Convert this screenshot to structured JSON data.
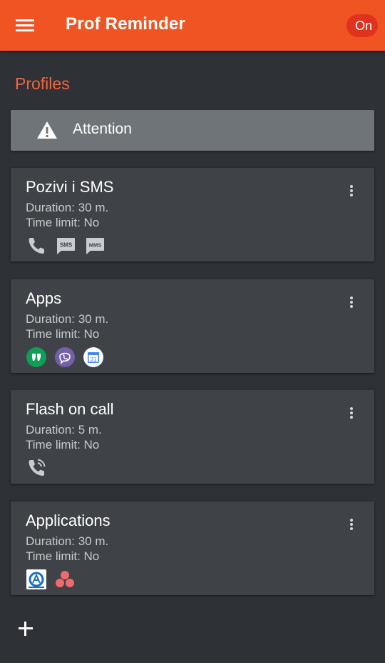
{
  "app": {
    "title": "Prof Reminder",
    "toggle_label": "On"
  },
  "section": {
    "title": "Profiles"
  },
  "attention": {
    "label": "Attention"
  },
  "profiles": [
    {
      "title": "Pozivi i SMS",
      "duration": "Duration: 30 m.",
      "time_limit": "Time limit: No",
      "icons": [
        "phone-icon",
        "sms-icon",
        "mms-icon"
      ]
    },
    {
      "title": "Apps",
      "duration": "Duration: 30 m.",
      "time_limit": "Time limit: No",
      "icons": [
        "hangouts-icon",
        "viber-icon",
        "calendar-icon"
      ]
    },
    {
      "title": "Flash on call",
      "duration": "Duration: 5 m.",
      "time_limit": "Time limit: No",
      "icons": [
        "phone-in-talk-icon"
      ]
    },
    {
      "title": "Applications",
      "duration": "Duration: 30 m.",
      "time_limit": "Time limit: No",
      "icons": [
        "a-app-icon",
        "asana-icon"
      ]
    }
  ],
  "icon_text": {
    "sms": "SMS",
    "mms": "MMS",
    "calendar_day": "31"
  },
  "colors": {
    "appbar": "#f05423",
    "toggle": "#e0321e",
    "accent_text": "#f0673f",
    "card": "#3f4347",
    "attention": "#6f7478",
    "background": "#2e3136"
  }
}
